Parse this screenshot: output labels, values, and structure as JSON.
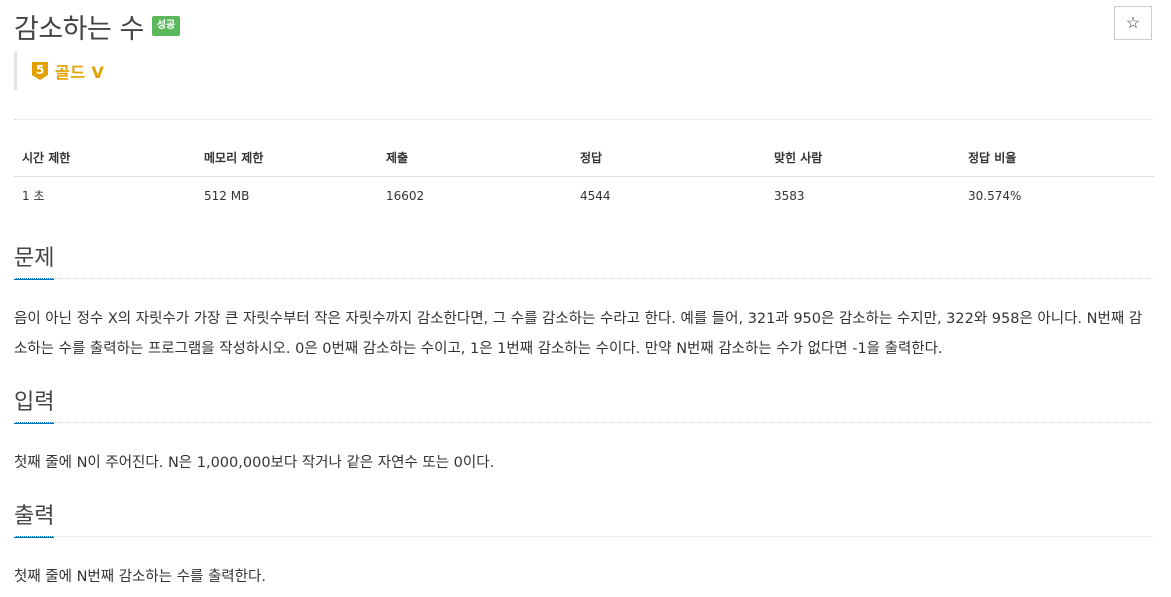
{
  "header": {
    "title": "감소하는 수",
    "result_badge": "성공",
    "star_icon": "☆"
  },
  "tier": {
    "level": "5",
    "label": "골드 V",
    "color": "#e1a100"
  },
  "info_table": {
    "headers": [
      "시간 제한",
      "메모리 제한",
      "제출",
      "정답",
      "맞힌 사람",
      "정답 비율"
    ],
    "values": [
      "1 초",
      "512 MB",
      "16602",
      "4544",
      "3583",
      "30.574%"
    ]
  },
  "sections": {
    "problem": {
      "heading": "문제",
      "body": "음이 아닌 정수 X의 자릿수가 가장 큰 자릿수부터 작은 자릿수까지 감소한다면, 그 수를 감소하는 수라고 한다. 예를 들어, 321과 950은 감소하는 수지만, 322와 958은 아니다. N번째 감소하는 수를 출력하는 프로그램을 작성하시오. 0은 0번째 감소하는 수이고, 1은 1번째 감소하는 수이다. 만약 N번째 감소하는 수가 없다면 -1을 출력한다."
    },
    "input": {
      "heading": "입력",
      "body": "첫째 줄에 N이 주어진다. N은 1,000,000보다 작거나 같은 자연수 또는 0이다."
    },
    "output": {
      "heading": "출력",
      "body": "첫째 줄에 N번째 감소하는 수를 출력한다."
    }
  }
}
